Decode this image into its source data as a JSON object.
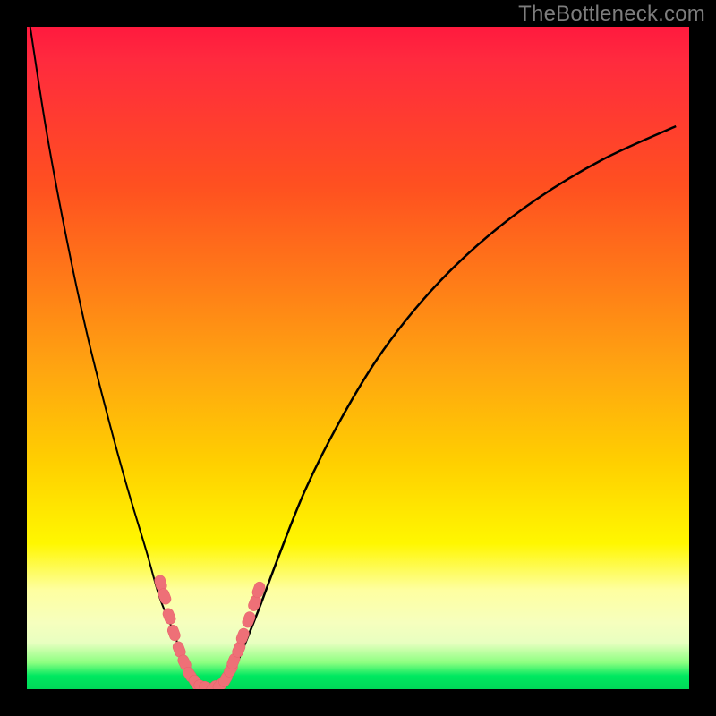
{
  "watermark": "TheBottleneck.com",
  "colors": {
    "frame_bg": "#000000",
    "gradient_top": "#ff1a3e",
    "gradient_mid1": "#ff7a18",
    "gradient_mid2": "#ffd000",
    "gradient_mid3": "#feffa0",
    "gradient_bottom": "#00d858",
    "curve_stroke": "#000000",
    "marker_fill": "#ee7077",
    "watermark_text": "#7d7d7d"
  },
  "chart_data": {
    "type": "line",
    "title": "",
    "xlabel": "",
    "ylabel": "",
    "xlim": [
      0,
      100
    ],
    "ylim": [
      0,
      100
    ],
    "grid": false,
    "legend": false,
    "note": "Axes are unlabeled in the image; x and y are normalized 0-100. y represents bottleneck percentage (lower is better, green band near 0).",
    "series": [
      {
        "name": "left-branch",
        "x": [
          0.5,
          3,
          6,
          9,
          12,
          15,
          18,
          20,
          22,
          23.5,
          25,
          26,
          27
        ],
        "y": [
          100,
          84,
          68,
          54,
          42,
          31,
          21,
          14,
          9,
          5,
          2,
          0.5,
          0
        ]
      },
      {
        "name": "right-branch",
        "x": [
          29,
          30,
          31.5,
          33,
          35,
          38,
          42,
          47,
          53,
          60,
          68,
          77,
          87,
          98
        ],
        "y": [
          0,
          1,
          3.5,
          7,
          12,
          20,
          30,
          40,
          50,
          59,
          67,
          74,
          80,
          85
        ]
      }
    ],
    "markers": {
      "name": "highlighted-points",
      "note": "Pink capsule-shaped markers clustered near the valley bottom on both branches.",
      "points": [
        {
          "x": 20.2,
          "y": 16
        },
        {
          "x": 20.8,
          "y": 14
        },
        {
          "x": 21.5,
          "y": 11
        },
        {
          "x": 22.2,
          "y": 8.5
        },
        {
          "x": 23.0,
          "y": 6
        },
        {
          "x": 23.8,
          "y": 4
        },
        {
          "x": 24.6,
          "y": 2.2
        },
        {
          "x": 25.5,
          "y": 1
        },
        {
          "x": 26.4,
          "y": 0.4
        },
        {
          "x": 27.2,
          "y": 0.2
        },
        {
          "x": 28.2,
          "y": 0.2
        },
        {
          "x": 29.2,
          "y": 0.6
        },
        {
          "x": 30.0,
          "y": 1.5
        },
        {
          "x": 30.8,
          "y": 3
        },
        {
          "x": 31.2,
          "y": 4.2
        },
        {
          "x": 32.0,
          "y": 6
        },
        {
          "x": 32.6,
          "y": 8
        },
        {
          "x": 33.5,
          "y": 10.5
        },
        {
          "x": 34.4,
          "y": 13
        },
        {
          "x": 35.0,
          "y": 15
        }
      ]
    }
  }
}
